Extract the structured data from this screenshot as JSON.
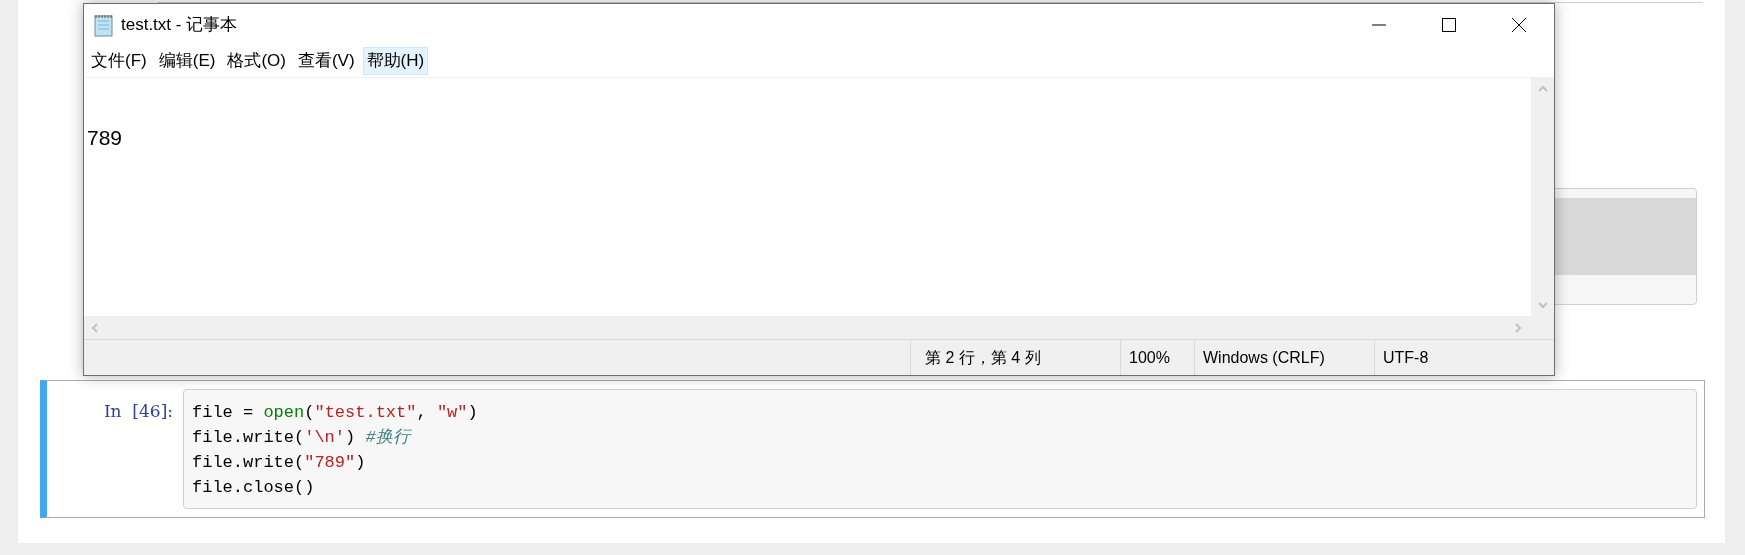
{
  "notepad": {
    "title": "test.txt - 记事本",
    "menu": [
      {
        "label": "文件(F)",
        "selected": false
      },
      {
        "label": "编辑(E)",
        "selected": false
      },
      {
        "label": "格式(O)",
        "selected": false
      },
      {
        "label": "查看(V)",
        "selected": false
      },
      {
        "label": "帮助(H)",
        "selected": true
      }
    ],
    "content": "789",
    "status_bar": {
      "position": "第 2 行，第 4 列",
      "zoom": "100%",
      "line_ending": "Windows (CRLF)",
      "encoding": "UTF-8"
    }
  },
  "code_cell": {
    "prompt": "In  [46]:",
    "lines": [
      [
        {
          "kind": "plain",
          "text": "file = "
        },
        {
          "kind": "builtin",
          "text": "open"
        },
        {
          "kind": "plain",
          "text": "("
        },
        {
          "kind": "string",
          "text": "\"test.txt\""
        },
        {
          "kind": "plain",
          "text": ", "
        },
        {
          "kind": "string",
          "text": "\"w\""
        },
        {
          "kind": "plain",
          "text": ")"
        }
      ],
      [
        {
          "kind": "plain",
          "text": "file.write("
        },
        {
          "kind": "string",
          "text": "'\\n'"
        },
        {
          "kind": "plain",
          "text": ") "
        },
        {
          "kind": "comment",
          "text": "#换行"
        }
      ],
      [
        {
          "kind": "plain",
          "text": "file.write("
        },
        {
          "kind": "string",
          "text": "\"789\""
        },
        {
          "kind": "plain",
          "text": ")"
        }
      ],
      [
        {
          "kind": "plain",
          "text": "file.close()"
        }
      ]
    ]
  }
}
